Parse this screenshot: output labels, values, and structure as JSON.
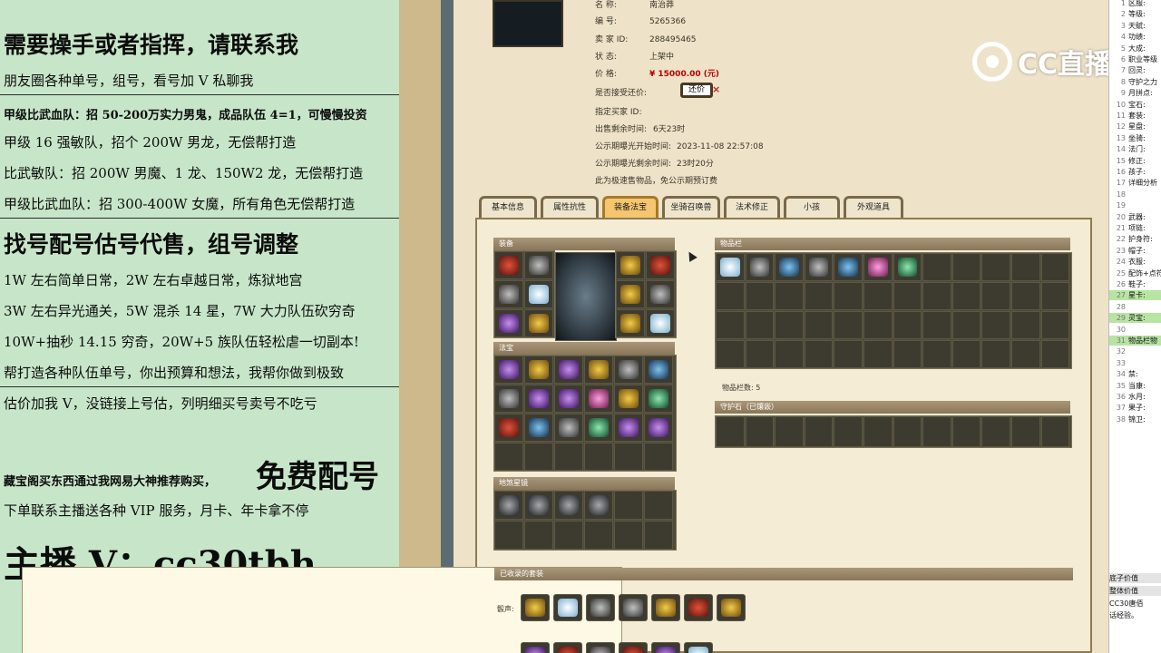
{
  "stream_overlay": {
    "heading_contact": "需要操手或者指挥，请联系我",
    "line_friends": "朋友圈各种单号，组号，看号加 V 私聊我",
    "team_a": "甲级比武血队：招 50-200万实力男鬼，成品队伍 4=1，可慢慢投资",
    "team_b": "甲级 16 强敏队，招个 200W 男龙，无偿帮打造",
    "team_c": "比武敏队：招 200W 男魔、1 龙、150W2 龙，无偿帮打造",
    "team_d": "甲级比武血队：招 300-400W 女魔，所有角色无偿帮打造",
    "heading_services": "找号配号估号代售，组号调整",
    "svc_1": "1W 左右简单日常，2W 左右卓越日常，炼狱地宫",
    "svc_2": "3W 左右异光通关，5W 混杀 14 星，7W 大力队伍砍穷奇",
    "svc_3": "10W+抽秒 14.15 穷奇，20W+5 族队伍轻松虐一切副本!",
    "svc_4": "帮打造各种队伍单号，你出预算和想法，我帮你做到极致",
    "svc_5": "估价加我 V，没链接上号估，列明细买号卖号不吃亏",
    "promo_line": "藏宝阁买东西通过我网易大神推荐购买，",
    "promo_big": "免费配号",
    "vip_line": "下单联系主播送各种 VIP 服务，月卡、年卡拿不停",
    "contact_v": "主播 V：cc30tbh"
  },
  "listing": {
    "name_label": "名    称:",
    "name_value": "南治莽",
    "id_label": "编    号:",
    "id_value": "5265366",
    "seller_label": "卖  家  ID:",
    "seller_value": "288495465",
    "status_label": "状    态:",
    "status_value": "上架中",
    "price_label": "价    格:",
    "price_value": "¥ 15000.00 (元)",
    "bargain_label": "是否接受还价:",
    "bargain_button": "还价",
    "close_icon": "×",
    "buyer_label": "指定买家 ID:",
    "remaining_label": "出售剩余时间:",
    "remaining_value": "6天23时",
    "public_start_label": "公示期曝光开始时间:",
    "public_start_value": "2023-11-08 22:57:08",
    "public_left_label": "公示期曝光剩余时间:",
    "public_left_value": "23时20分",
    "note": "此为极速售物品，免公示期预订费"
  },
  "tabs": [
    {
      "label": "基本信息",
      "active": false
    },
    {
      "label": "属性抗性",
      "active": false
    },
    {
      "label": "装备法宝",
      "active": true
    },
    {
      "label": "坐骑召唤兽",
      "active": false
    },
    {
      "label": "法术修正",
      "active": false
    },
    {
      "label": "小孩",
      "active": false
    },
    {
      "label": "外观道具",
      "active": false
    }
  ],
  "sections": {
    "equipment": "装备",
    "magic": "法宝",
    "spirit": "地煞星镜",
    "inventory": "物品栏",
    "inventory_count": "物品栏数: 5",
    "guard_stone": "守护石（已镶嵌）",
    "collected_sets": "已收录的套装",
    "sets_row_label": "骰声:"
  },
  "right_sheet": {
    "rows": [
      {
        "n": "1",
        "t": "区服:"
      },
      {
        "n": "2",
        "t": "等级:"
      },
      {
        "n": "3",
        "t": "天赋:"
      },
      {
        "n": "4",
        "t": "功绩:"
      },
      {
        "n": "5",
        "t": "大成:"
      },
      {
        "n": "6",
        "t": "职业等级"
      },
      {
        "n": "7",
        "t": "回灵:"
      },
      {
        "n": "8",
        "t": "守护之力"
      },
      {
        "n": "9",
        "t": "月拼点:"
      },
      {
        "n": "10",
        "t": "宝石:"
      },
      {
        "n": "11",
        "t": "套装:"
      },
      {
        "n": "12",
        "t": "星盘:"
      },
      {
        "n": "13",
        "t": "坐骑:"
      },
      {
        "n": "14",
        "t": "法门:"
      },
      {
        "n": "15",
        "t": "修正:"
      },
      {
        "n": "16",
        "t": "孩子:"
      },
      {
        "n": "17",
        "t": "详细分析"
      },
      {
        "n": "18",
        "t": ""
      },
      {
        "n": "19",
        "t": ""
      },
      {
        "n": "20",
        "t": "武器:"
      },
      {
        "n": "21",
        "t": "项链:"
      },
      {
        "n": "22",
        "t": "护身符:"
      },
      {
        "n": "23",
        "t": "帽子:"
      },
      {
        "n": "24",
        "t": "衣服:"
      },
      {
        "n": "25",
        "t": "配饰+点符"
      },
      {
        "n": "26",
        "t": "鞋子:"
      },
      {
        "n": "27",
        "t": "星卡:"
      },
      {
        "n": "28",
        "t": ""
      },
      {
        "n": "29",
        "t": "灵宝:"
      },
      {
        "n": "30",
        "t": ""
      },
      {
        "n": "31",
        "t": "物品栏物"
      },
      {
        "n": "32",
        "t": ""
      },
      {
        "n": "33",
        "t": ""
      },
      {
        "n": "34",
        "t": "禁:"
      },
      {
        "n": "35",
        "t": "当康:"
      },
      {
        "n": "36",
        "t": "水月:"
      },
      {
        "n": "37",
        "t": "果子:"
      },
      {
        "n": "38",
        "t": "锦卫:"
      }
    ],
    "footer_1": "底子价值",
    "footer_2": "整体价值",
    "footer_3": "CC30唐佰",
    "footer_4": "话经验。"
  },
  "watermark": {
    "text": "CC直播",
    "icon": "cc-logo-icon"
  }
}
